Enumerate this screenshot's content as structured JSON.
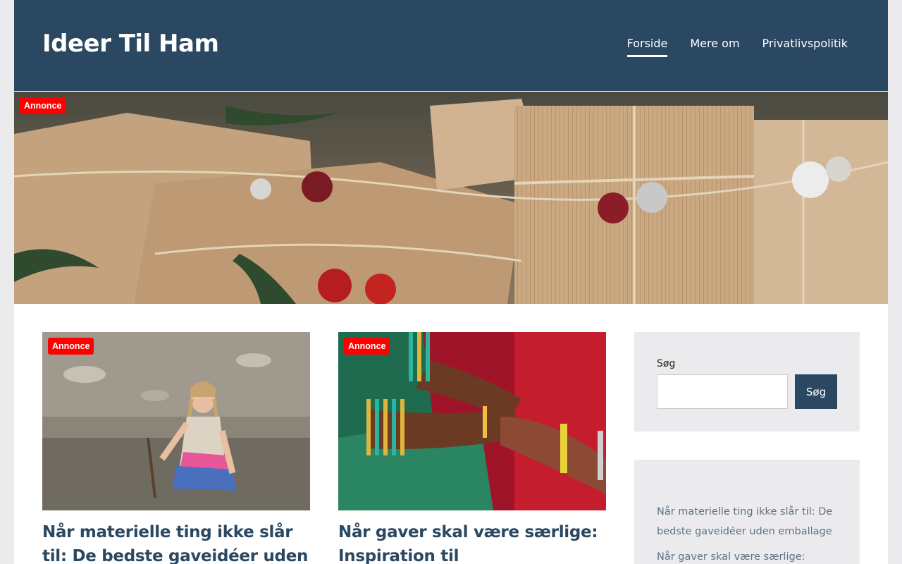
{
  "site": {
    "title": "Ideer Til Ham"
  },
  "nav": {
    "items": [
      {
        "label": "Forside"
      },
      {
        "label": "Mere om"
      },
      {
        "label": "Privatlivspolitik"
      }
    ]
  },
  "hero": {
    "badge": "Annonce"
  },
  "posts": [
    {
      "badge": "Annonce",
      "title": "Når materielle ting ikke slår til: De bedste gaveidéer uden emballage"
    },
    {
      "badge": "Annonce",
      "title": "Når gaver skal være særlige: Inspiration til krondiamantbryllup"
    }
  ],
  "sidebar": {
    "search": {
      "label": "Søg",
      "button": "Søg",
      "value": ""
    },
    "recent_posts": [
      "Når materielle ting ikke slår til: De bedste gaveidéer uden emballage",
      "Når gaver skal være særlige:"
    ]
  },
  "colors": {
    "header_bg": "#2a4861",
    "badge_bg": "#ff0000",
    "link": "#2a4861",
    "sidebar_bg": "#ebebed"
  }
}
